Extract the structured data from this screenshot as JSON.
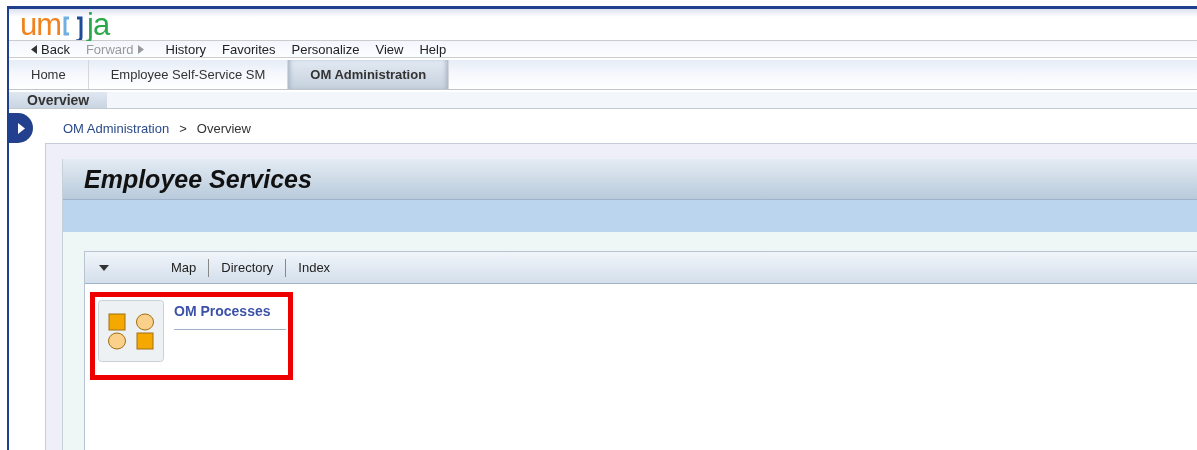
{
  "logo": {
    "text_start": "um",
    "text_end": "ja"
  },
  "nav": [
    {
      "label": "Back",
      "kind": "back",
      "disabled": false
    },
    {
      "label": "Forward",
      "kind": "forward",
      "disabled": true
    },
    {
      "label": "History",
      "kind": "menu",
      "disabled": false
    },
    {
      "label": "Favorites",
      "kind": "menu",
      "disabled": false
    },
    {
      "label": "Personalize",
      "kind": "menu",
      "disabled": false
    },
    {
      "label": "View",
      "kind": "menu",
      "disabled": false
    },
    {
      "label": "Help",
      "kind": "menu",
      "disabled": false
    }
  ],
  "tabs": [
    {
      "label": "Home",
      "selected": false
    },
    {
      "label": "Employee Self-Service SM",
      "selected": false
    },
    {
      "label": "OM Administration",
      "selected": true
    }
  ],
  "subtabs": [
    {
      "label": "Overview",
      "selected": true
    }
  ],
  "breadcrumb": {
    "link": "OM Administration",
    "separator": ">",
    "current": "Overview"
  },
  "page_title": "Employee Services",
  "view_tabs": [
    "Map",
    "Directory",
    "Index"
  ],
  "tiles": [
    {
      "title": "OM Processes",
      "highlighted": true
    }
  ]
}
